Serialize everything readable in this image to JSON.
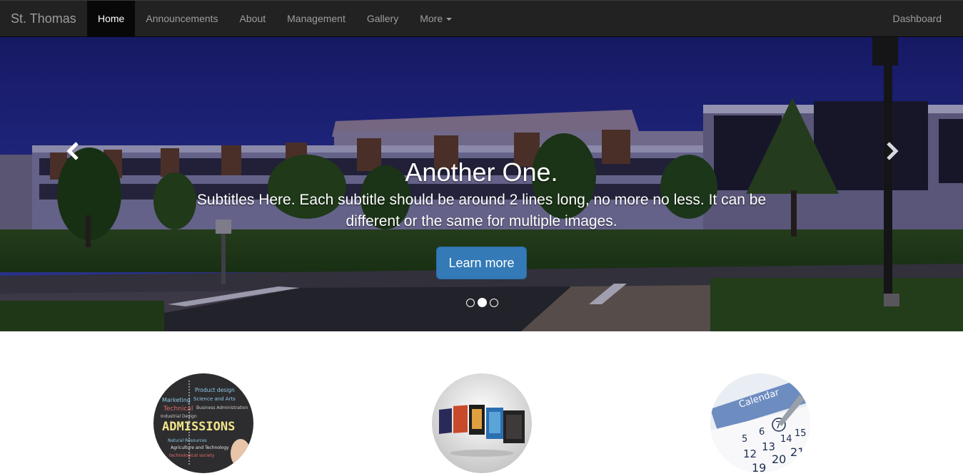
{
  "brand": "St. Thomas",
  "nav": {
    "items": [
      {
        "label": "Home",
        "active": true
      },
      {
        "label": "Announcements"
      },
      {
        "label": "About"
      },
      {
        "label": "Management"
      },
      {
        "label": "Gallery"
      },
      {
        "label": "More",
        "dropdown": true
      }
    ],
    "right": "Dashboard"
  },
  "carousel": {
    "title": "Another One.",
    "subtitle": "Subtitles Here. Each subtitle should be around 2 lines long, no more no less. It can be different or the same for multiple images.",
    "button": "Learn more",
    "slide_count": 3,
    "active_slide": 2,
    "prev_icon": "chevron-left-icon",
    "next_icon": "chevron-right-icon"
  },
  "features": {
    "admissions_text": "ADMISSIONS",
    "admissions_words": [
      "Marketing",
      "Product design",
      "Technical",
      "Science and Arts",
      "Industrial Design",
      "Business Administration",
      "Natural Resources",
      "Agriculture and Technology",
      "technological society"
    ],
    "calendar_text": "Calendar",
    "calendar_days": [
      "5",
      "6",
      "7",
      "14",
      "15",
      "12",
      "13",
      "20",
      "21",
      "19"
    ]
  },
  "colors": {
    "navbar_bg": "#222222",
    "nav_active_bg": "#080808",
    "nav_text": "#9d9d9d",
    "button_primary": "#337ab7"
  }
}
